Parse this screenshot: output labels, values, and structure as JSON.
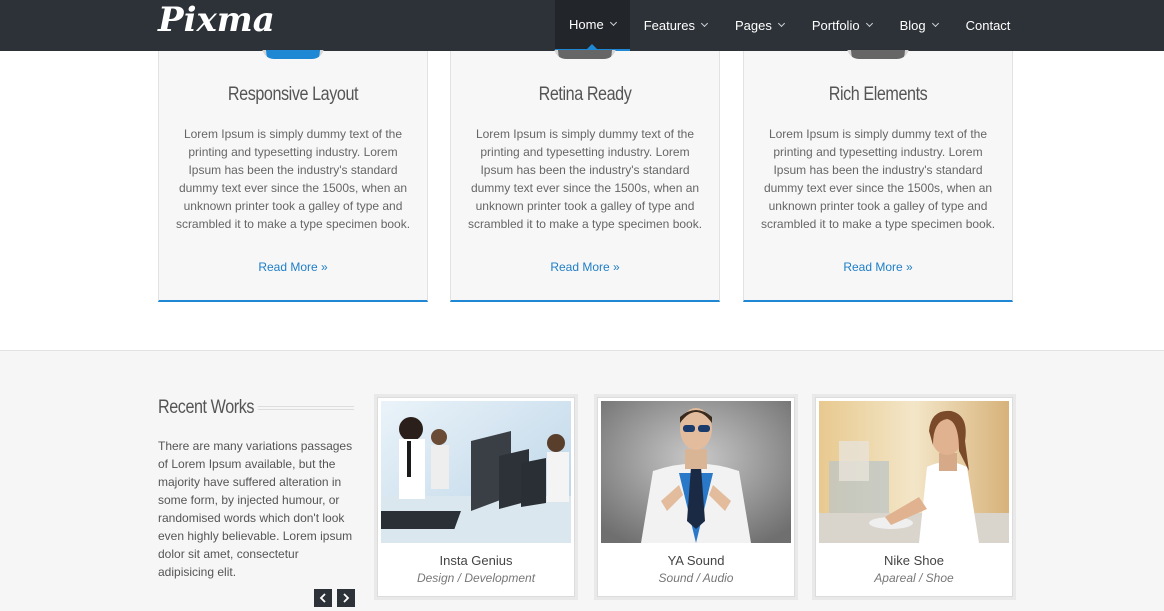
{
  "header": {
    "logo": "Pixma",
    "nav": [
      {
        "label": "Home",
        "dropdown": true,
        "active": true
      },
      {
        "label": "Features",
        "dropdown": true
      },
      {
        "label": "Pages",
        "dropdown": true
      },
      {
        "label": "Portfolio",
        "dropdown": true
      },
      {
        "label": "Blog",
        "dropdown": true
      },
      {
        "label": "Contact",
        "dropdown": false
      }
    ]
  },
  "features": [
    {
      "title": "Responsive Layout",
      "text": "Lorem Ipsum is simply dummy text of the printing and typesetting industry. Lorem Ipsum has been the industry's standard dummy text ever since the 1500s, when an unknown printer took a galley of type and scrambled it to make a type specimen book.",
      "link": "Read More »"
    },
    {
      "title": "Retina Ready",
      "text": "Lorem Ipsum is simply dummy text of the printing and typesetting industry. Lorem Ipsum has been the industry's standard dummy text ever since the 1500s, when an unknown printer took a galley of type and scrambled it to make a type specimen book.",
      "link": "Read More »"
    },
    {
      "title": "Rich Elements",
      "text": "Lorem Ipsum is simply dummy text of the printing and typesetting industry. Lorem Ipsum has been the industry's standard dummy text ever since the 1500s, when an unknown printer took a galley of type and scrambled it to make a type specimen book.",
      "link": "Read More »"
    }
  ],
  "works": {
    "title": "Recent Works",
    "description": "There are many variations passages of Lorem Ipsum available, but the majority have suffered alteration in some form, by injected humour, or randomised words which don't look even highly believable. Lorem ipsum dolor sit amet, consectetur adipisicing elit.",
    "prev_icon": "chevron-left-icon",
    "next_icon": "chevron-right-icon",
    "items": [
      {
        "name": "Insta Genius",
        "category": "Design / Development"
      },
      {
        "name": "YA Sound",
        "category": "Sound / Audio"
      },
      {
        "name": "Nike Shoe",
        "category": "Apareal / Shoe"
      }
    ]
  },
  "colors": {
    "header_bg": "#2d3238",
    "accent": "#1e88d4",
    "section_bg": "#f6f6f6"
  }
}
